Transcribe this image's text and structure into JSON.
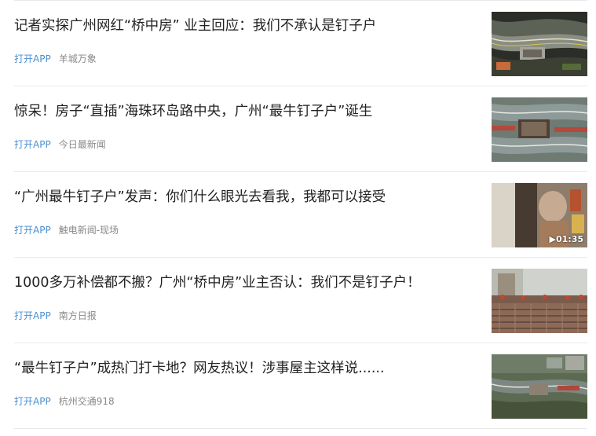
{
  "feed": {
    "items": [
      {
        "title": "记者实探广州网红“桥中房” 业主回应：我们不承认是钉子户",
        "action": "打开APP",
        "source": "羊城万象"
      },
      {
        "title": "惊呆！房子“直插”海珠环岛路中央，广州“最牛钉子户”诞生",
        "action": "打开APP",
        "source": "今日最新闻"
      },
      {
        "title": "“广州最牛钉子户”发声：你们什么眼光去看我，我都可以接受",
        "action": "打开APP",
        "source": "触电新闻-现场",
        "duration": "01:35"
      },
      {
        "title": "1000多万补偿都不搬？广州“桥中房”业主否认：我们不是钉子户！",
        "action": "打开APP",
        "source": "南方日报"
      },
      {
        "title": "“最牛钉子户”成热门打卡地？网友热议！涉事屋主这样说......",
        "action": "打开APP",
        "source": "杭州交通918"
      }
    ]
  },
  "colors": {
    "title": "#222222",
    "open_app": "#4a8fd0",
    "source": "#888888",
    "divider": "#e9e9e9"
  }
}
